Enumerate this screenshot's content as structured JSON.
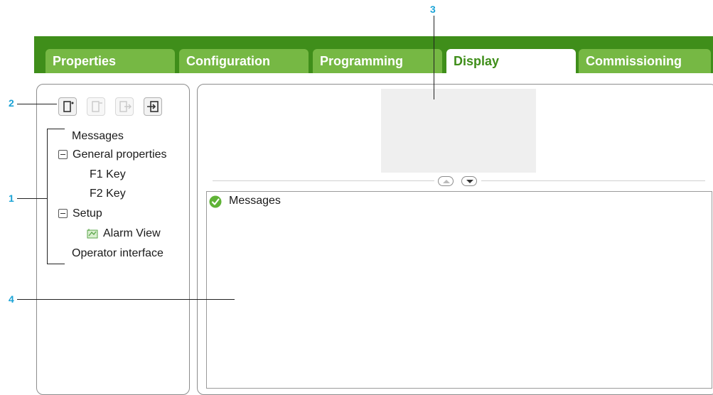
{
  "tabs": [
    {
      "label": "Properties",
      "active": false
    },
    {
      "label": "Configuration",
      "active": false
    },
    {
      "label": "Programming",
      "active": false
    },
    {
      "label": "Display",
      "active": true
    },
    {
      "label": "Commissioning",
      "active": false
    }
  ],
  "toolbar": {
    "buttons": [
      {
        "icon": "add-screen-icon",
        "enabled": true
      },
      {
        "icon": "remove-screen-icon",
        "enabled": false
      },
      {
        "icon": "export-icon",
        "enabled": false
      },
      {
        "icon": "import-icon",
        "enabled": true
      }
    ]
  },
  "tree": {
    "items": [
      {
        "label": "Messages"
      },
      {
        "label": "General properties",
        "expanded": true
      },
      {
        "label": "F1 Key"
      },
      {
        "label": "F2 Key"
      },
      {
        "label": "Setup",
        "expanded": true
      },
      {
        "label": "Alarm View",
        "icon": "alarm-view-icon"
      },
      {
        "label": "Operator interface"
      }
    ]
  },
  "message_panel": {
    "title": "Messages",
    "status_icon": "check-icon"
  },
  "callouts": {
    "c1": "1",
    "c2": "2",
    "c3": "3",
    "c4": "4"
  },
  "colors": {
    "tab_bar": "#3f8e1a",
    "tab": "#76b844",
    "callout": "#1aa3d6"
  }
}
